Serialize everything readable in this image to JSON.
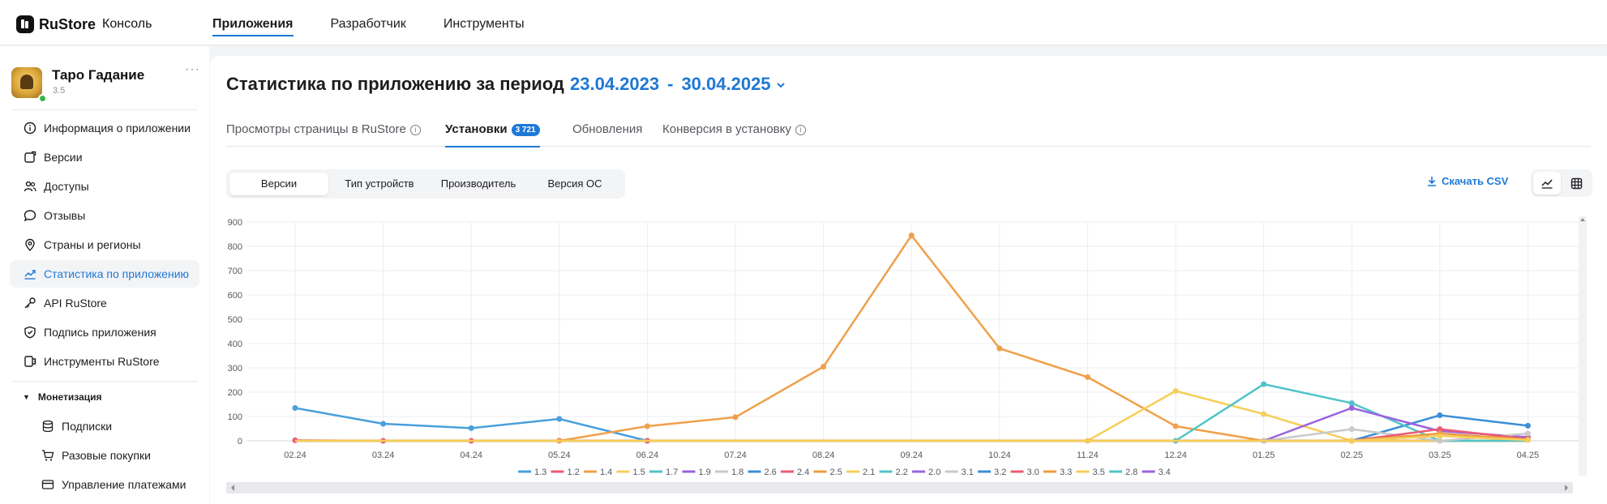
{
  "topbar": {
    "brand": "RuStore",
    "brand_sub": "Консоль",
    "nav": [
      {
        "label": "Приложения",
        "active": true
      },
      {
        "label": "Разработчик",
        "active": false
      },
      {
        "label": "Инструменты",
        "active": false
      }
    ]
  },
  "app": {
    "name": "Таро Гадание",
    "version": "3.5",
    "more": "···"
  },
  "sidebar": {
    "items": [
      {
        "label": "Информация о приложении",
        "icon": "info-icon"
      },
      {
        "label": "Версии",
        "icon": "versions-icon"
      },
      {
        "label": "Доступы",
        "icon": "users-icon"
      },
      {
        "label": "Отзывы",
        "icon": "chat-bubble-icon"
      },
      {
        "label": "Страны и регионы",
        "icon": "location-pin-icon"
      },
      {
        "label": "Статистика по приложению",
        "icon": "trend-chart-icon",
        "active": true
      },
      {
        "label": "API RuStore",
        "icon": "key-icon"
      },
      {
        "label": "Подпись приложения",
        "icon": "shield-check-icon"
      },
      {
        "label": "Инструменты RuStore",
        "icon": "tools-icon"
      }
    ],
    "section": "Монетизация",
    "sub_items": [
      {
        "label": "Подписки",
        "icon": "database-icon"
      },
      {
        "label": "Разовые покупки",
        "icon": "cart-icon"
      },
      {
        "label": "Управление платежами",
        "icon": "card-icon"
      }
    ]
  },
  "header": {
    "title": "Статистика по приложению за период",
    "date_from": "23.04.2023",
    "separator": "-",
    "date_to": "30.04.2025"
  },
  "tabs": [
    {
      "label": "Просмотры страницы в RuStore",
      "info": "i"
    },
    {
      "label": "Установки",
      "badge": "3 721",
      "active": true
    },
    {
      "label": "Обновления"
    },
    {
      "label": "Конверсия в установку",
      "info": "i"
    }
  ],
  "segments": [
    {
      "label": "Версии",
      "active": true
    },
    {
      "label": "Тип устройств"
    },
    {
      "label": "Производитель"
    },
    {
      "label": "Версия ОС"
    }
  ],
  "download_csv": "Скачать CSV",
  "colors": {
    "accent": "#1e78d6",
    "active_tab_underline": "#1e78d6"
  },
  "chart_data": {
    "type": "line",
    "ylim": [
      0,
      900
    ],
    "yticks": [
      0,
      100,
      200,
      300,
      400,
      500,
      600,
      700,
      800,
      900
    ],
    "categories": [
      "02.24",
      "03.24",
      "04.24",
      "05.24",
      "06.24",
      "07.24",
      "08.24",
      "09.24",
      "10.24",
      "11.24",
      "12.24",
      "01.25",
      "02.25",
      "03.25",
      "04.25"
    ],
    "grid": true,
    "legend_position": "bottom",
    "series": [
      {
        "name": "1.3",
        "color": "#4a9fdc",
        "values": [
          135,
          70,
          52,
          90,
          0,
          0,
          0,
          0,
          0,
          0,
          0,
          0,
          0,
          0,
          0
        ]
      },
      {
        "name": "1.2",
        "color": "#ec5a73",
        "values": [
          2,
          0,
          0,
          1,
          0,
          0,
          0,
          0,
          0,
          0,
          0,
          0,
          0,
          0,
          0
        ]
      },
      {
        "name": "1.4",
        "color": "#f0a04a",
        "values": [
          0,
          0,
          0,
          0,
          60,
          97,
          305,
          845,
          380,
          262,
          60,
          0,
          0,
          0,
          0
        ]
      },
      {
        "name": "1.5",
        "color": "#f5cf58",
        "values": [
          0,
          0,
          0,
          0,
          0,
          0,
          0,
          0,
          0,
          0,
          0,
          0,
          0,
          0,
          0
        ]
      },
      {
        "name": "1.7",
        "color": "#52c3c8",
        "values": [
          0,
          0,
          0,
          0,
          0,
          0,
          0,
          0,
          0,
          0,
          0,
          0,
          0,
          0,
          0
        ]
      },
      {
        "name": "1.9",
        "color": "#9a63e0",
        "values": [
          0,
          0,
          0,
          0,
          0,
          0,
          0,
          0,
          0,
          0,
          0,
          0,
          0,
          0,
          0
        ]
      },
      {
        "name": "1.8",
        "color": "#c9c9c9",
        "values": [
          0,
          0,
          0,
          0,
          0,
          0,
          0,
          0,
          0,
          0,
          0,
          0,
          0,
          0,
          0
        ]
      },
      {
        "name": "2.6",
        "color": "#3b8fd6",
        "values": [
          0,
          0,
          0,
          0,
          0,
          0,
          0,
          0,
          0,
          0,
          0,
          0,
          0,
          105,
          62
        ]
      },
      {
        "name": "2.4",
        "color": "#ec5a73",
        "values": [
          0,
          0,
          0,
          0,
          0,
          0,
          0,
          0,
          0,
          0,
          0,
          0,
          0,
          0,
          0
        ]
      },
      {
        "name": "2.5",
        "color": "#ef9a3c",
        "values": [
          0,
          0,
          0,
          0,
          0,
          0,
          0,
          0,
          0,
          0,
          0,
          0,
          0,
          0,
          0
        ]
      },
      {
        "name": "2.1",
        "color": "#f5cf58",
        "values": [
          0,
          0,
          0,
          0,
          0,
          0,
          0,
          0,
          0,
          0,
          205,
          110,
          0,
          0,
          0
        ]
      },
      {
        "name": "2.2",
        "color": "#4fc4c9",
        "values": [
          0,
          0,
          0,
          0,
          0,
          0,
          0,
          0,
          0,
          0,
          0,
          233,
          155,
          0,
          0
        ]
      },
      {
        "name": "2.0",
        "color": "#9a63e0",
        "values": [
          0,
          0,
          0,
          0,
          0,
          0,
          0,
          0,
          0,
          0,
          0,
          0,
          135,
          40,
          15
        ]
      },
      {
        "name": "3.1",
        "color": "#c9c9c9",
        "values": [
          0,
          0,
          0,
          0,
          0,
          0,
          0,
          0,
          0,
          0,
          0,
          0,
          48,
          0,
          30
        ]
      },
      {
        "name": "3.2",
        "color": "#3b8fd6",
        "values": [
          0,
          0,
          0,
          0,
          0,
          0,
          0,
          0,
          0,
          0,
          0,
          0,
          0,
          0,
          0
        ]
      },
      {
        "name": "3.0",
        "color": "#ec5a73",
        "values": [
          0,
          0,
          0,
          0,
          0,
          0,
          0,
          0,
          0,
          0,
          0,
          0,
          0,
          48,
          8
        ]
      },
      {
        "name": "3.3",
        "color": "#ef9a3c",
        "values": [
          0,
          0,
          0,
          0,
          0,
          0,
          0,
          0,
          0,
          0,
          0,
          0,
          0,
          30,
          5
        ]
      },
      {
        "name": "3.5",
        "color": "#f5cf58",
        "values": [
          0,
          0,
          0,
          0,
          0,
          0,
          0,
          0,
          0,
          0,
          0,
          0,
          0,
          20,
          3
        ]
      },
      {
        "name": "2.8",
        "color": "#4fc4c9",
        "values": [
          0,
          0,
          0,
          0,
          0,
          0,
          0,
          0,
          0,
          0,
          0,
          0,
          0,
          0,
          0
        ]
      },
      {
        "name": "3.4",
        "color": "#9a63e0",
        "values": [
          0,
          0,
          0,
          0,
          0,
          0,
          0,
          0,
          0,
          0,
          0,
          0,
          0,
          0,
          0
        ]
      }
    ]
  }
}
